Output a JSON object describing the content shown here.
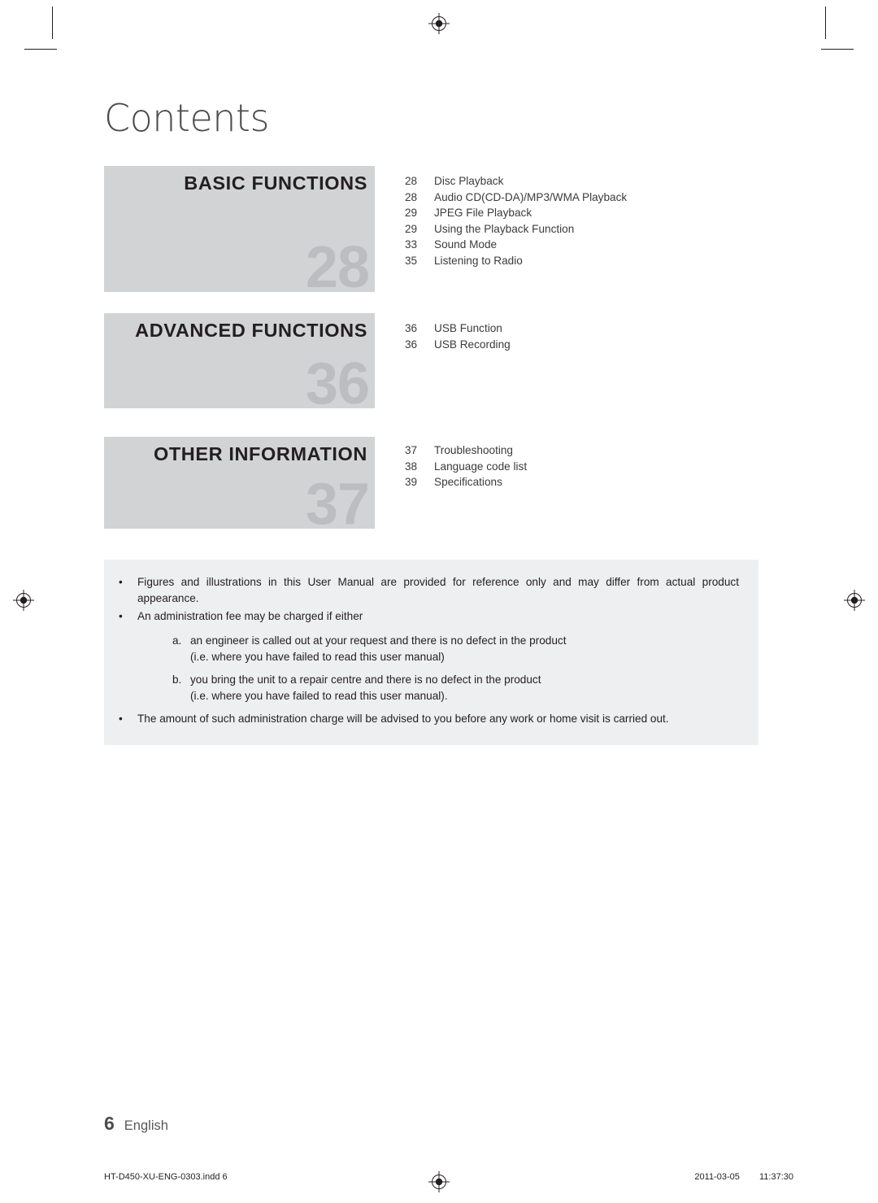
{
  "page": {
    "title": "Contents",
    "number": "6",
    "language": "English"
  },
  "sections": [
    {
      "title": "BASIC FUNCTIONS",
      "number": "28",
      "entries": [
        {
          "page": "28",
          "title": "Disc Playback"
        },
        {
          "page": "28",
          "title": "Audio CD(CD-DA)/MP3/WMA Playback"
        },
        {
          "page": "29",
          "title": "JPEG File Playback"
        },
        {
          "page": "29",
          "title": "Using the Playback Function"
        },
        {
          "page": "33",
          "title": "Sound Mode"
        },
        {
          "page": "35",
          "title": "Listening to Radio"
        }
      ]
    },
    {
      "title": "ADVANCED FUNCTIONS",
      "number": "36",
      "entries": [
        {
          "page": "36",
          "title": "USB Function"
        },
        {
          "page": "36",
          "title": "USB Recording"
        }
      ]
    },
    {
      "title": "OTHER INFORMATION",
      "number": "37",
      "entries": [
        {
          "page": "37",
          "title": "Troubleshooting"
        },
        {
          "page": "38",
          "title": "Language code list"
        },
        {
          "page": "39",
          "title": "Specifications"
        }
      ]
    }
  ],
  "notes": {
    "bullet": "•",
    "item1": "Figures and illustrations in this User Manual are provided for reference only and may differ from actual product appearance.",
    "item2": "An administration fee may be charged if either",
    "sub_a_label": "a.",
    "sub_a_text": "an engineer is called out at your request and there is no defect in the product",
    "sub_a_cont": "(i.e. where you have failed to read this user manual)",
    "sub_b_label": "b.",
    "sub_b_text": "you bring the unit to a repair centre and there is no defect in the product",
    "sub_b_cont": "(i.e. where you have failed to read this user manual).",
    "item3": "The amount of such administration charge will be advised to you before any work or home visit is carried out."
  },
  "print_footer": {
    "file": "HT-D450-XU-ENG-0303.indd   6",
    "date": "2011-03-05",
    "time": "11:37:30"
  }
}
